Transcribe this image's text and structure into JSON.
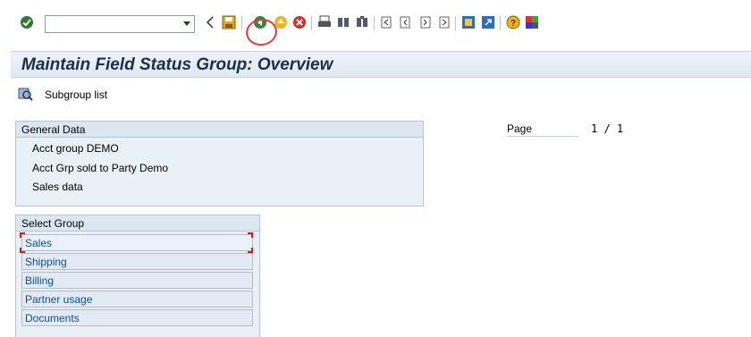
{
  "toolbar": {
    "command_field_value": "",
    "icons": [
      "enter-checkmark-icon",
      "back-arrow-icon",
      "save-icon",
      "back-icon",
      "exit-icon",
      "cancel-icon",
      "print-icon",
      "find-icon",
      "find-next-icon",
      "first-page-icon",
      "previous-page-icon",
      "next-page-icon",
      "last-page-icon",
      "create-session-icon",
      "shortcut-icon",
      "help-icon",
      "customize-layout-icon"
    ]
  },
  "title": "Maintain Field Status Group: Overview",
  "app_toolbar": {
    "subgroup_list_label": "Subgroup list"
  },
  "general_data": {
    "heading": "General Data",
    "acct_group": "Acct group  DEMO",
    "acct_grp_desc": "Acct Grp sold to Party Demo",
    "sales_data": "Sales data"
  },
  "paging": {
    "label": "Page",
    "value": "1 / 1"
  },
  "select_group": {
    "heading": "Select Group",
    "items": [
      {
        "label": "Sales"
      },
      {
        "label": "Shipping"
      },
      {
        "label": "Billing"
      },
      {
        "label": "Partner usage"
      },
      {
        "label": "Documents"
      }
    ]
  },
  "colors": {
    "title_text": "#1b2f4a",
    "link_text": "#0a4f9e",
    "annotation_red": "#e03a3a"
  }
}
